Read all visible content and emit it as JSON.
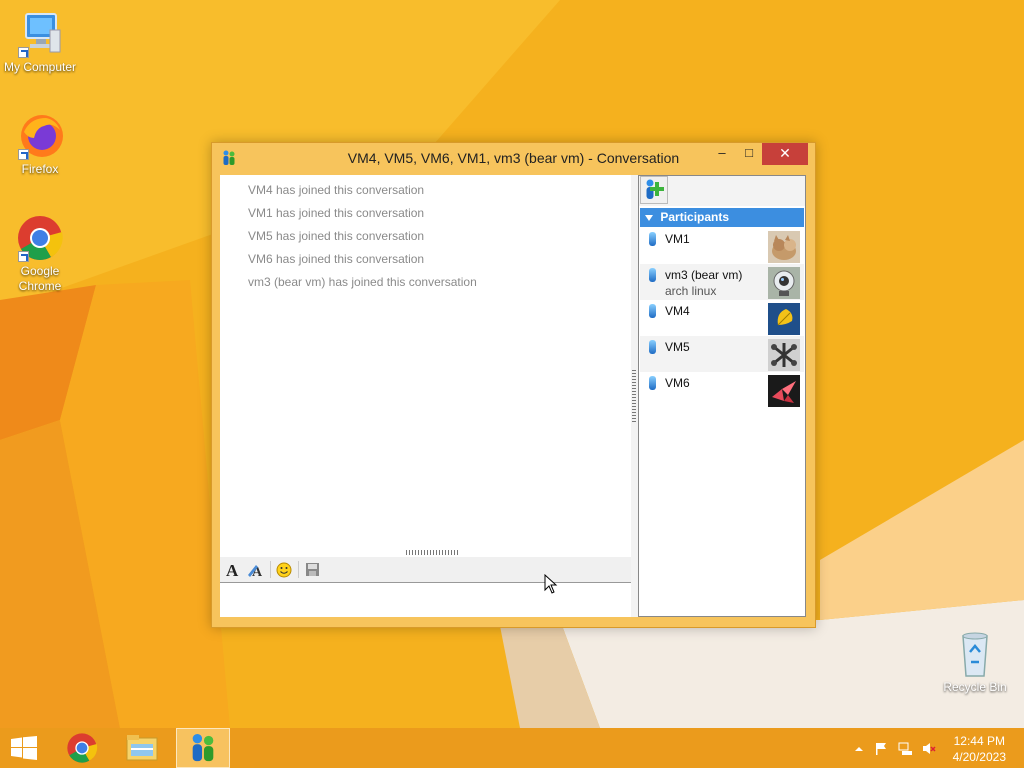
{
  "desktop": {
    "icons": [
      {
        "label": "My Computer"
      },
      {
        "label": "Firefox"
      },
      {
        "label": "Google Chrome"
      },
      {
        "label": "Recycle Bin"
      }
    ]
  },
  "window": {
    "title": "VM4, VM5, VM6, VM1, vm3 (bear vm) - Conversation",
    "controls": {
      "minimize": "–",
      "maximize": "□",
      "close": "✕"
    }
  },
  "chat": {
    "messages": [
      "VM4 has joined this conversation",
      "VM1 has joined this conversation",
      "VM5 has joined this conversation",
      "VM6 has joined this conversation",
      "vm3 (bear vm) has joined this conversation"
    ],
    "input_value": ""
  },
  "participants": {
    "header": "Participants",
    "items": [
      {
        "name": "VM1",
        "status": "",
        "avatar": "kitten-avatar"
      },
      {
        "name": "vm3 (bear vm)",
        "status": "arch linux",
        "avatar": "webcam-avatar"
      },
      {
        "name": "VM4",
        "status": "",
        "avatar": "leaf-avatar"
      },
      {
        "name": "VM5",
        "status": "",
        "avatar": "jacks-avatar"
      },
      {
        "name": "VM6",
        "status": "",
        "avatar": "origami-crane-avatar"
      }
    ]
  },
  "taskbar": {
    "time": "12:44 PM",
    "date": "4/20/2023"
  },
  "colors": {
    "accent": "#3c8ee0",
    "close": "#c7403a",
    "window_frame": "#f7c45c",
    "taskbar": "#e9991c"
  }
}
